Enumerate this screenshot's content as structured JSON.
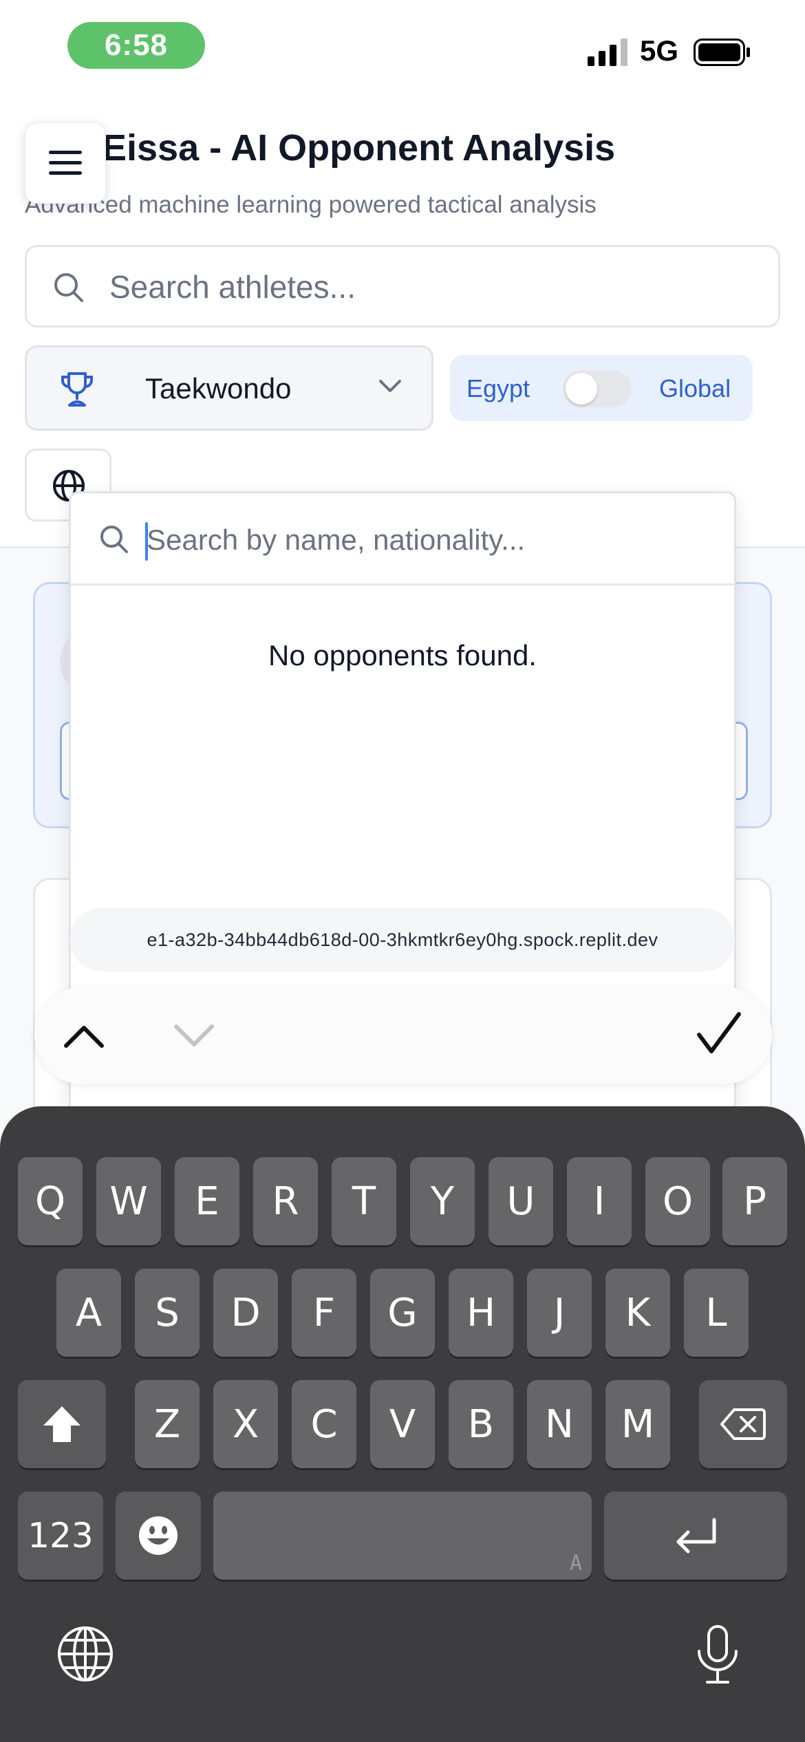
{
  "status_bar": {
    "time": "6:58",
    "network": "5G"
  },
  "header": {
    "title": "Eissa - AI Opponent Analysis",
    "subtitle": "Advanced machine learning powered tactical analysis"
  },
  "athlete_search": {
    "placeholder": "Search athletes...",
    "value": ""
  },
  "sport_select": {
    "selected": "Taekwondo",
    "icon": "trophy-icon"
  },
  "region_toggle": {
    "left_label": "Egypt",
    "right_label": "Global",
    "is_global": false
  },
  "opponent_combobox": {
    "placeholder": "Search by name, nationality...",
    "value": "",
    "empty_text": "No opponents found."
  },
  "browser": {
    "url": "e1-a32b-34bb44db618d-00-3hkmtkr6ey0hg.spock.replit.dev"
  },
  "keyboard": {
    "row1": [
      "Q",
      "W",
      "E",
      "R",
      "T",
      "Y",
      "U",
      "I",
      "O",
      "P"
    ],
    "row2": [
      "A",
      "S",
      "D",
      "F",
      "G",
      "H",
      "J",
      "K",
      "L"
    ],
    "row3": [
      "Z",
      "X",
      "C",
      "V",
      "B",
      "N",
      "M"
    ],
    "numbers_key": "123",
    "space_hint": "A"
  },
  "colors": {
    "time_pill": "#5ec26a",
    "accent_blue": "#2f5fd0",
    "keyboard_bg": "#3d3d3f",
    "key_bg": "#666668"
  }
}
